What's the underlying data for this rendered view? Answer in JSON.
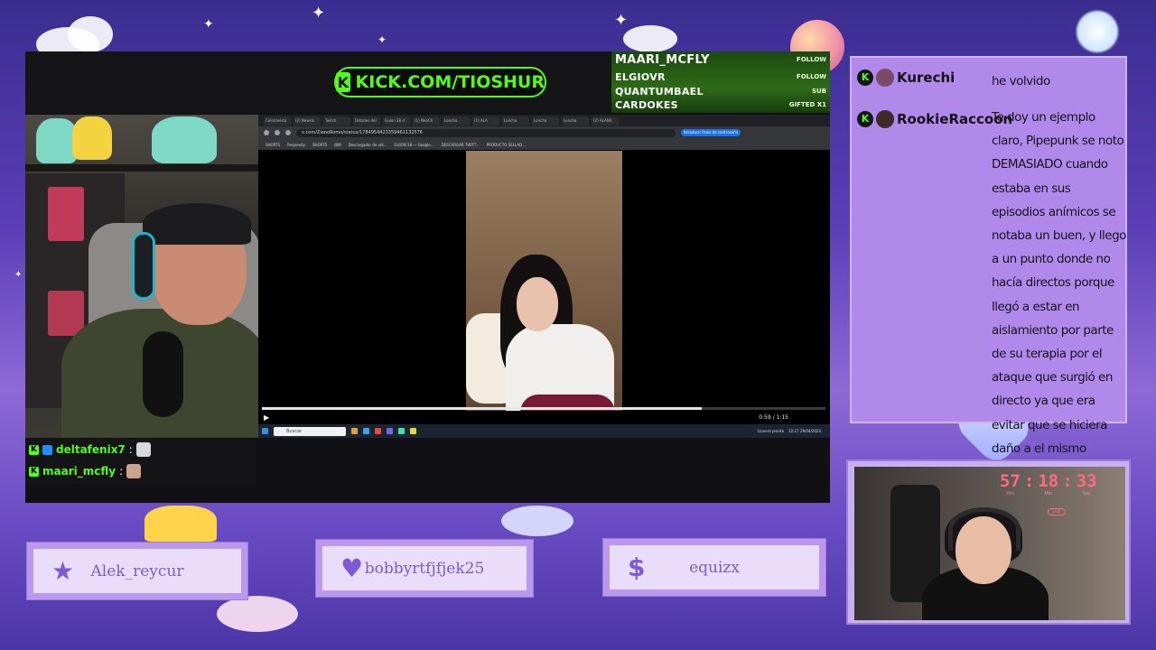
{
  "kick_badge": {
    "icon": "kick-logo-icon",
    "text": "KICK.COM/TIOSHUR",
    "color": "#53fc18"
  },
  "alerts": [
    {
      "name": "MAARI_MCFLY",
      "type": "FOLLOW"
    },
    {
      "name": "ELGIOVR",
      "type": "FOLLOW"
    },
    {
      "name": "QUANTUMBAEL",
      "type": "SUB"
    },
    {
      "name": "CARDOKES",
      "type": "GIFTED X1"
    }
  ],
  "browser": {
    "tabs": [
      "Colonavista",
      "(2) Newslo",
      "Twitch",
      "Detalles del",
      "Guion 28 d",
      "(1) NeoCh",
      "Loncha",
      "(1) ALA",
      "Loncha",
      "Loncha",
      "Loncha",
      "(2) ALANA"
    ],
    "url": "x.com/ZianoRomo/status/1784954423359461132576",
    "url_action": "Introducir frase de contraseña",
    "bookmarks": [
      "SHORTS",
      "Perplexity",
      "SHORTS",
      "IBM",
      "Descargador de víd...",
      "GUION 28 — Google...",
      "DESCARGAR TWITT...",
      "PRODUCTO SELLAD..."
    ],
    "video_time": "0:59 / 1:15",
    "video_progress": 0.78,
    "search_placeholder": "Buscar",
    "tray_weather": "Lloverá pronto",
    "tray_clock": "22:17 29/04/2024"
  },
  "mini_chat": [
    {
      "name": "deltafenix7",
      "colon": ":"
    },
    {
      "name": "maari_mcfly",
      "colon": ":"
    }
  ],
  "chat": [
    {
      "user": "Kurechi",
      "message": "he volvido"
    },
    {
      "user": "RookieRaccoon",
      "message": "Te doy un ejemplo claro, Pipepunk se noto DEMASIADO cuando estaba en sus episodios anímicos se notaba un buen, y llego a un punto donde no hacía directos porque llegó a estar en aislamiento por parte de su terapia por el ataque que surgió en directo ya que era evitar que se hiciera daño a el mismo"
    }
  ],
  "events": [
    {
      "icon": "star-icon",
      "glyph": "★",
      "name": "Alek_reycur"
    },
    {
      "icon": "heart-icon",
      "glyph": "♥",
      "name": "bobbyrtfjfjek25"
    },
    {
      "icon": "dollar-icon",
      "glyph": "$",
      "name": "equizx"
    }
  ],
  "timer": {
    "hours": "57",
    "minutes": "18",
    "seconds": "33",
    "hours_label": "Hrs",
    "minutes_label": "Min",
    "seconds_label": "Sec",
    "live": "LIVE",
    "color": "#ff6b7d"
  },
  "colors": {
    "kick_green": "#53fc18",
    "panel_purple": "#b089ea",
    "event_text": "#7b5bc9"
  }
}
